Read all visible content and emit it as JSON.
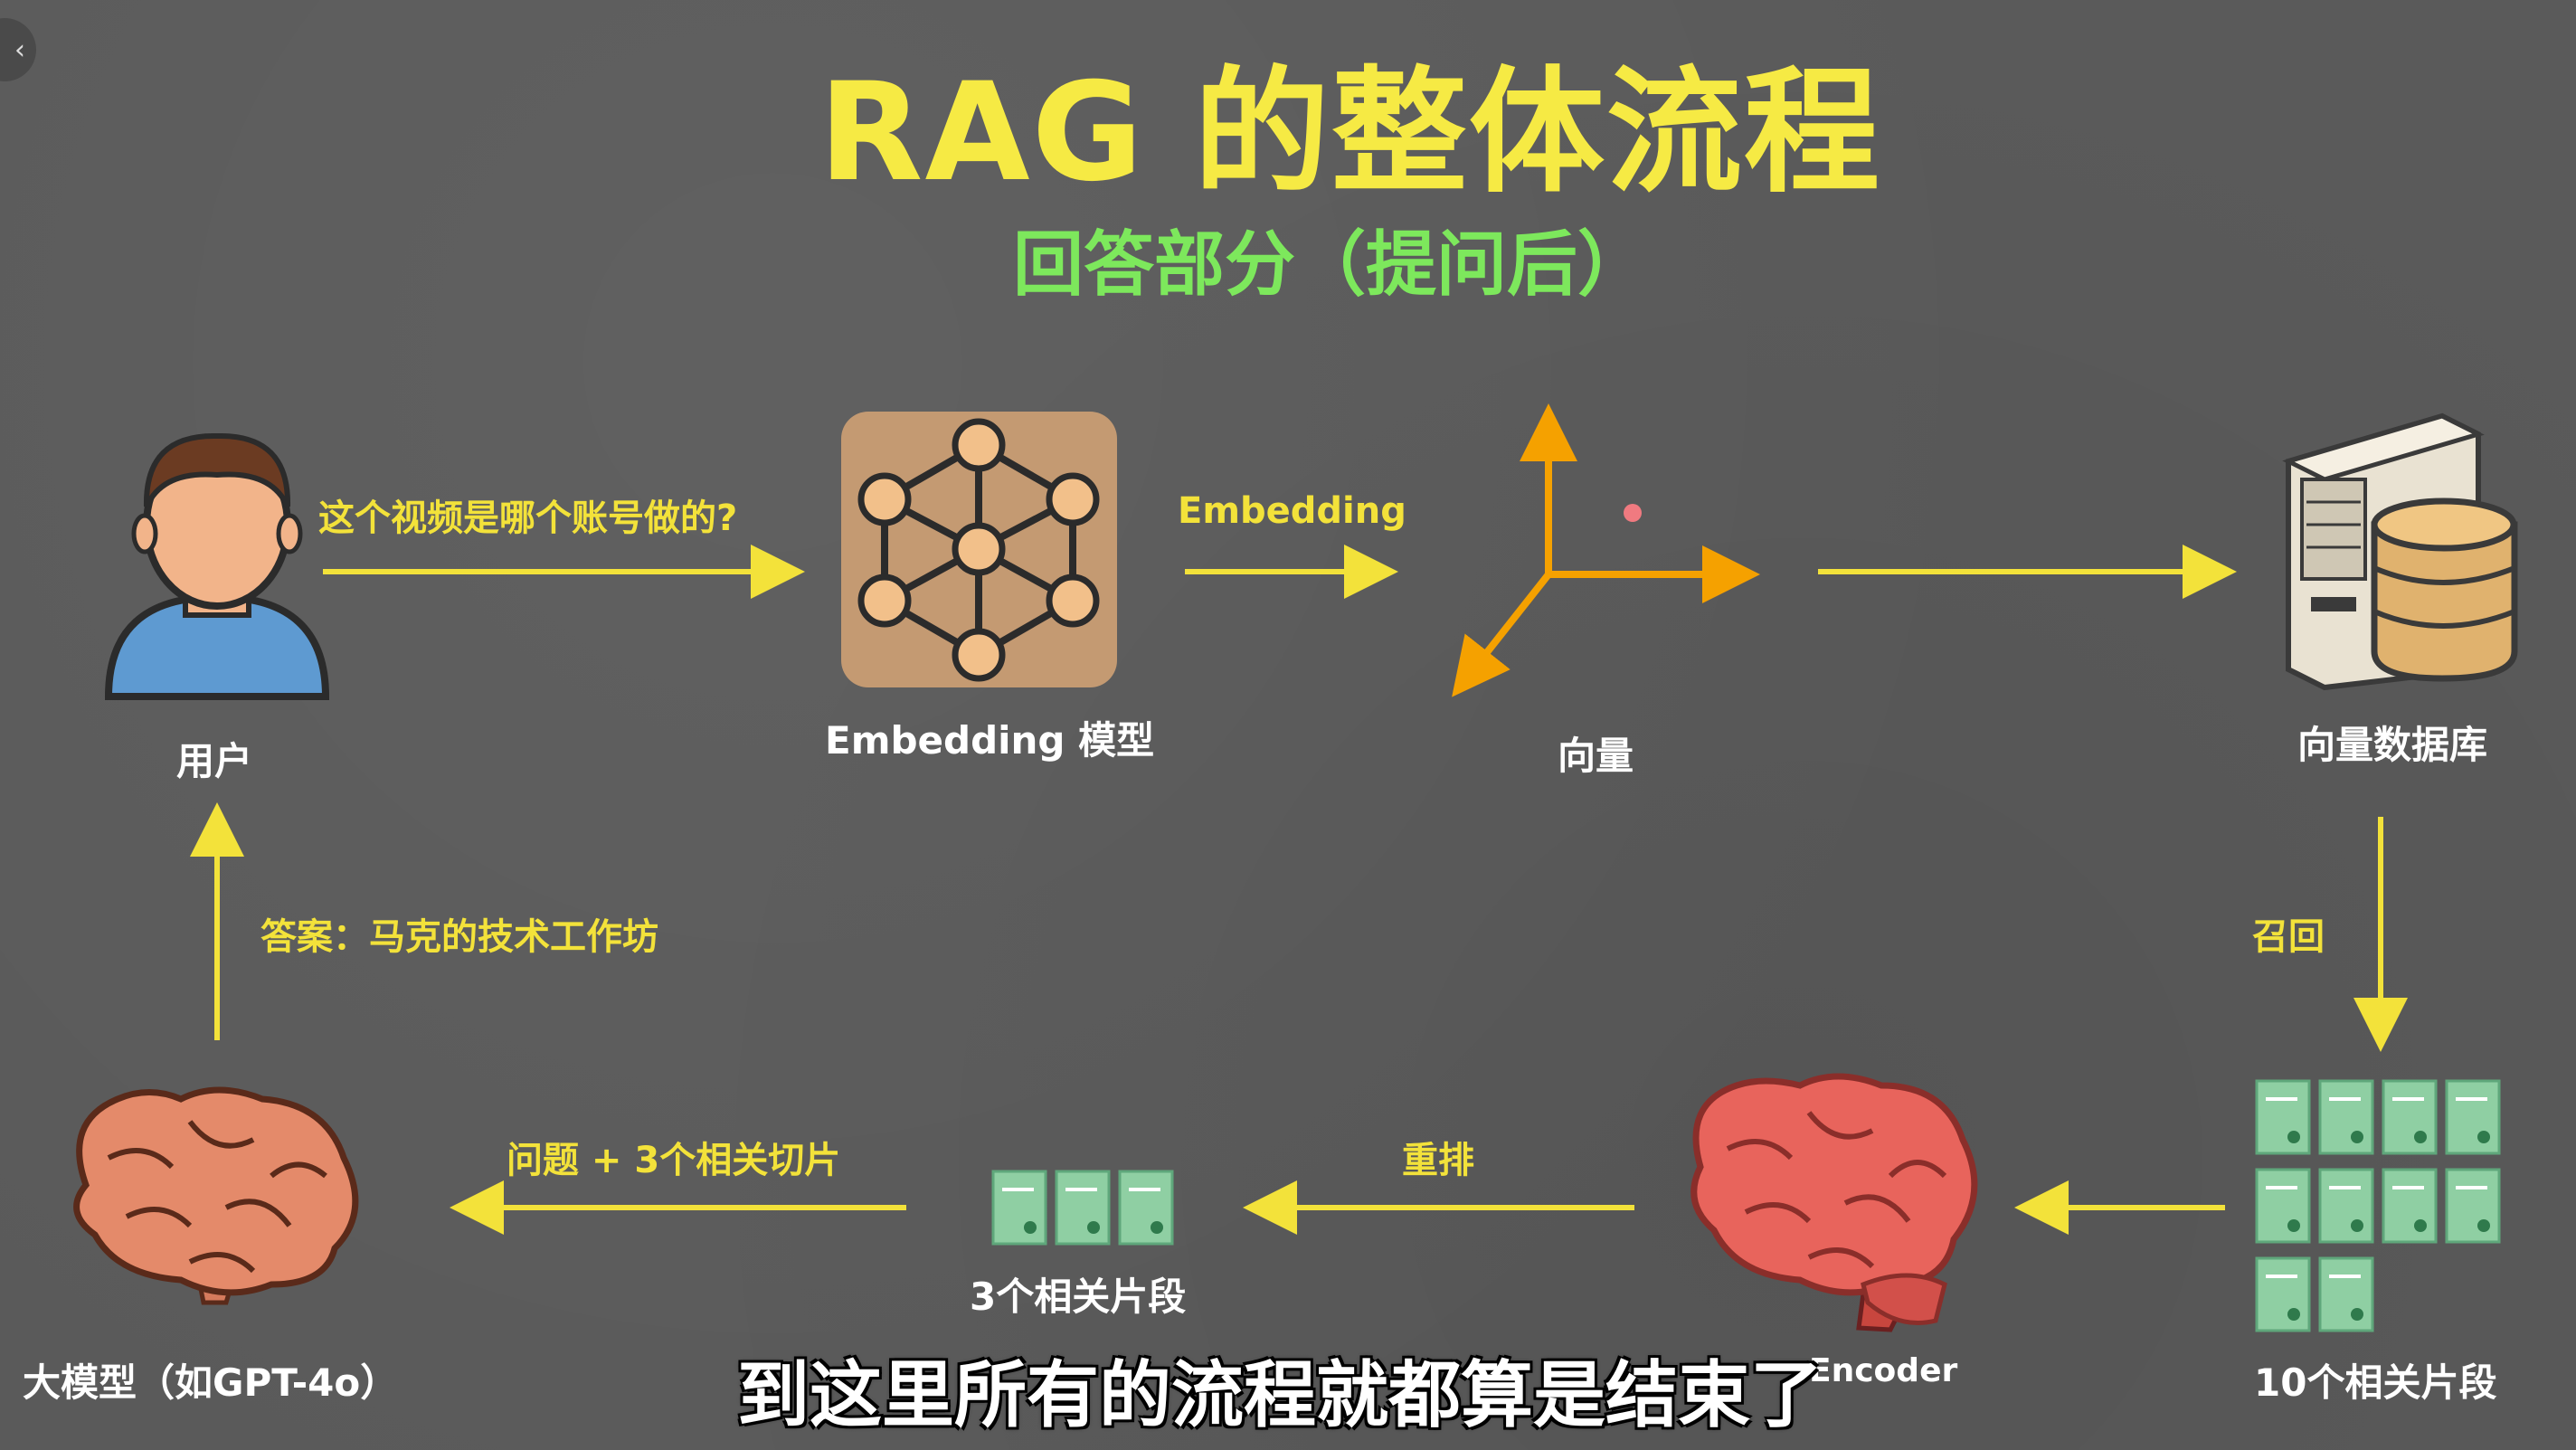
{
  "title": "RAG 的整体流程",
  "subtitle": "回答部分（提问后）",
  "nodes": {
    "user": "用户",
    "embedding_model": "Embedding 模型",
    "vector": "向量",
    "vector_db": "向量数据库",
    "ten_chunks": "10个相关片段",
    "reranker_partial": "Encoder",
    "three_chunks": "3个相关片段",
    "llm": "大模型（如GPT-4o）"
  },
  "edges": {
    "question": "这个视频是哪个账号做的?",
    "embedding": "Embedding",
    "recall": "召回",
    "rerank": "重排",
    "to_llm": "问题 + 3个相关切片",
    "answer": "答案：马克的技术工作坊"
  },
  "caption": "到这里所有的流程就都算是结束了",
  "colors": {
    "title": "#f6ea44",
    "subtitle": "#7de85c",
    "arrow": "#f3e23a",
    "axis": "#f5a100",
    "brain": "#e48a6a",
    "red_brain": "#e8645c",
    "chunk": "#7fc99a"
  },
  "icons": [
    "back-icon",
    "user-icon",
    "network-icon",
    "axes-icon",
    "server-database-icon",
    "document-chunk-icon",
    "brain-icon"
  ]
}
